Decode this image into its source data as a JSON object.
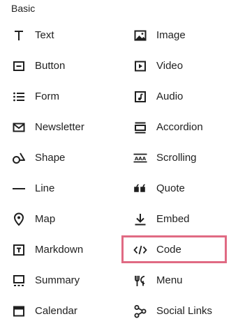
{
  "section": {
    "title": "Basic"
  },
  "colors": {
    "highlight": "#e06a83",
    "text": "#1f1f1f"
  },
  "left_items": [
    {
      "label": "Text",
      "icon": "text-t-icon"
    },
    {
      "label": "Button",
      "icon": "button-icon"
    },
    {
      "label": "Form",
      "icon": "form-list-icon"
    },
    {
      "label": "Newsletter",
      "icon": "envelope-icon"
    },
    {
      "label": "Shape",
      "icon": "shape-icon"
    },
    {
      "label": "Line",
      "icon": "line-icon"
    },
    {
      "label": "Map",
      "icon": "map-pin-icon"
    },
    {
      "label": "Markdown",
      "icon": "markdown-icon"
    },
    {
      "label": "Summary",
      "icon": "summary-icon"
    },
    {
      "label": "Calendar",
      "icon": "calendar-icon"
    }
  ],
  "right_items": [
    {
      "label": "Image",
      "icon": "image-icon"
    },
    {
      "label": "Video",
      "icon": "video-play-icon"
    },
    {
      "label": "Audio",
      "icon": "audio-note-icon"
    },
    {
      "label": "Accordion",
      "icon": "accordion-icon"
    },
    {
      "label": "Scrolling",
      "icon": "scrolling-text-icon"
    },
    {
      "label": "Quote",
      "icon": "quote-icon"
    },
    {
      "label": "Embed",
      "icon": "embed-download-icon"
    },
    {
      "label": "Code",
      "icon": "code-icon",
      "highlighted": true
    },
    {
      "label": "Menu",
      "icon": "menu-fork-knife-icon"
    },
    {
      "label": "Social Links",
      "icon": "social-links-icon"
    }
  ]
}
